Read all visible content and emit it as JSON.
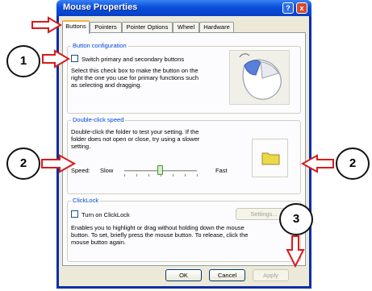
{
  "window": {
    "title": "Mouse Properties",
    "help_label": "?",
    "close_label": "x"
  },
  "tabs": [
    {
      "label": "Buttons"
    },
    {
      "label": "Pointers"
    },
    {
      "label": "Pointer Options"
    },
    {
      "label": "Wheel"
    },
    {
      "label": "Hardware"
    }
  ],
  "button_config": {
    "title": "Button configuration",
    "checkbox_label": "Switch primary and secondary buttons",
    "checked": false,
    "desc_lines": [
      "Select this check box to make the button on the",
      "right the one you use for primary functions such",
      "as selecting and dragging."
    ]
  },
  "double_click": {
    "title": "Double-click speed",
    "desc_lines": [
      "Double-click the folder to test your setting. If the",
      "folder does not open or close, try using a slower",
      "setting."
    ],
    "speed_label": "Speed:",
    "slow_label": "Slow",
    "fast_label": "Fast",
    "speed_value": 0.5
  },
  "clicklock": {
    "title": "ClickLock",
    "checkbox_label": "Turn on ClickLock",
    "checked": false,
    "settings_label": "Settings...",
    "desc_lines": [
      "Enables you to highlight or drag without holding down the mouse",
      "button. To set, briefly press the mouse button. To release, click the",
      "mouse button again."
    ]
  },
  "buttons": {
    "ok": "OK",
    "cancel": "Cancel",
    "apply": "Apply"
  },
  "annotations": [
    {
      "label": "1"
    },
    {
      "label": "2"
    },
    {
      "label": "2"
    },
    {
      "label": "3"
    }
  ],
  "colors": {
    "annotation_red": "#d81b1b",
    "xp_blue": "#0a3fc7",
    "group_title_blue": "#0046d5"
  }
}
